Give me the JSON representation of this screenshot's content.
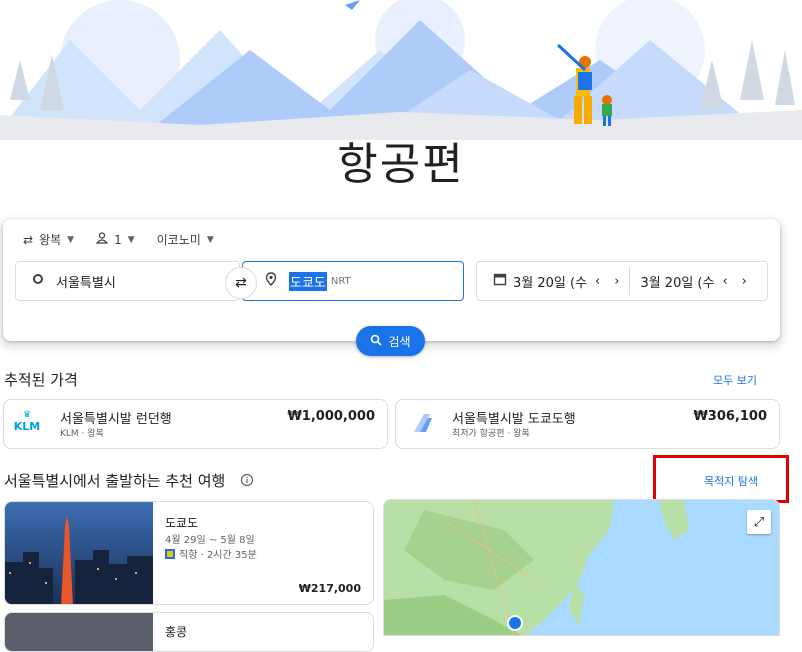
{
  "title": "항공편",
  "search": {
    "trip_type": "왕복",
    "passengers": "1",
    "cabin": "이코노미",
    "from_value": "서울특별시",
    "to_value": "도쿄도",
    "to_code": "NRT",
    "depart_date": "3월 20일 (수",
    "return_date": "3월 20일 (수",
    "button_label": "검색"
  },
  "tracked": {
    "heading": "추적된 가격",
    "see_all": "모두 보기",
    "items": [
      {
        "airline_logo": "KLM",
        "title": "서울특별시발 런던행",
        "sub": "KLM · 왕복",
        "price": "₩1,000,000"
      },
      {
        "title": "서울특별시발 도쿄도행",
        "sub": "최저가 항공편 · 왕복",
        "price": "₩306,100"
      }
    ]
  },
  "recommended": {
    "heading": "서울특별시에서 출발하는 추천 여행",
    "explore_link": "목적지 탐색",
    "cards": [
      {
        "city": "도쿄도",
        "dates": "4월 29일 ~ 5월 8일",
        "flight": "직항 · 2시간 35분",
        "price": "₩217,000"
      },
      {
        "city": "홍콩"
      }
    ]
  },
  "colors": {
    "accent": "#1a73e8",
    "highlight": "#e00000"
  }
}
